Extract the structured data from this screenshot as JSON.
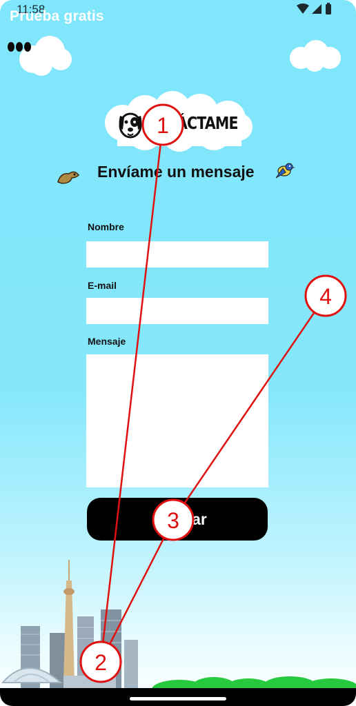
{
  "status_bar": {
    "time": "11:58"
  },
  "header": {
    "promo_label": "Prueba gratis",
    "menu_icon": "more-dots-icon"
  },
  "logo": {
    "text": "ÁCTAME",
    "icon": "dog-face-icon"
  },
  "page": {
    "title": "Envíame un mensaje"
  },
  "form": {
    "name_label": "Nombre",
    "name_value": "",
    "email_label": "E-mail",
    "email_value": "",
    "message_label": "Mensaje",
    "message_value": "",
    "send_label": "ar"
  },
  "annotations": [
    {
      "label": "1"
    },
    {
      "label": "2"
    },
    {
      "label": "3"
    },
    {
      "label": "4"
    }
  ],
  "colors": {
    "background_top": "#7fe6fb",
    "annotation_red": "#e01010",
    "button": "#000000",
    "grass": "#27c93f"
  }
}
